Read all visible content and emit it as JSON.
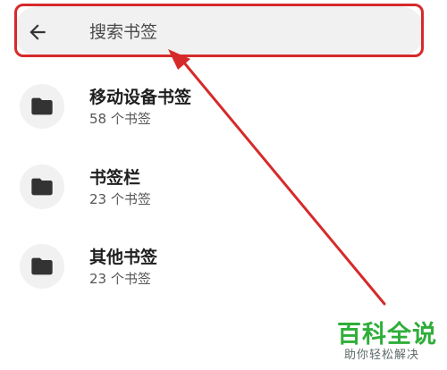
{
  "search": {
    "placeholder": "搜索书签",
    "back_icon": "arrow-left-icon"
  },
  "folders": [
    {
      "title": "移动设备书签",
      "count": "58 个书签",
      "icon": "folder-icon"
    },
    {
      "title": "书签栏",
      "count": "23 个书签",
      "icon": "folder-icon"
    },
    {
      "title": "其他书签",
      "count": "23 个书签",
      "icon": "folder-icon"
    }
  ],
  "annotation": {
    "highlight_color": "#d62a2a"
  },
  "watermark": {
    "title": "百科全说",
    "subtitle": "助你轻松解决",
    "title_color": "#2fae3a"
  }
}
